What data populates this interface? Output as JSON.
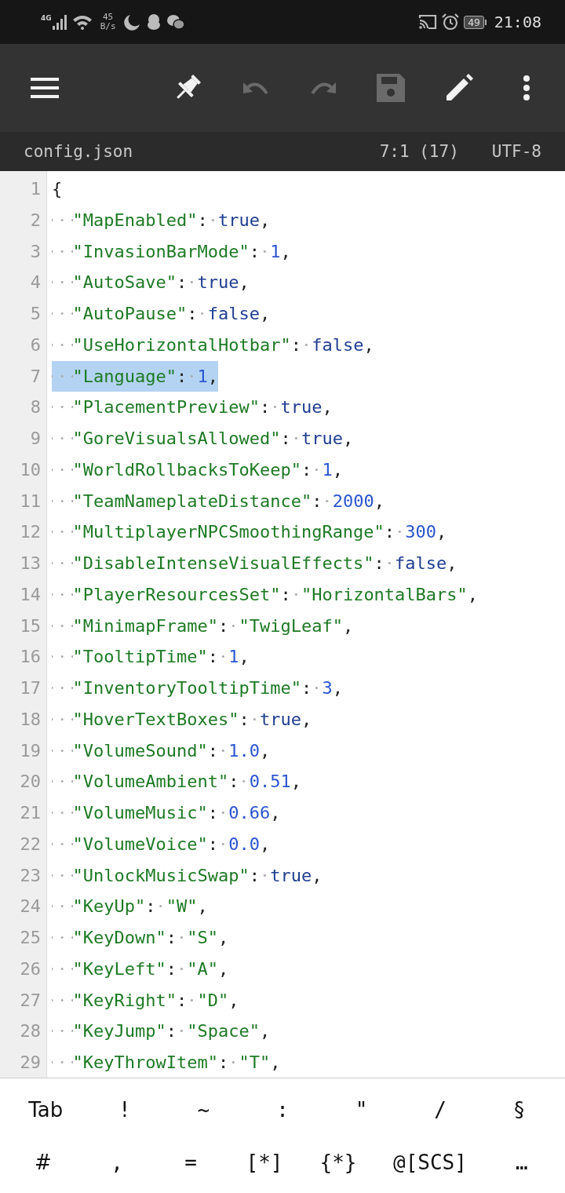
{
  "status_bar": {
    "network": "4G",
    "speed_value": "45",
    "speed_unit": "B/s",
    "battery": "49",
    "time": "21:08"
  },
  "toolbar": [
    {
      "disabled": false
    },
    {
      "disabled": false
    },
    {
      "disabled": true
    },
    {
      "disabled": true
    },
    {
      "disabled": true
    },
    {
      "disabled": false
    },
    {
      "disabled": false
    }
  ],
  "file_bar": {
    "filename": "config.json",
    "position": "7:1 (17)",
    "encoding": "UTF-8"
  },
  "lines": [
    {
      "number": "1",
      "kind": "brace",
      "text": "{",
      "selected": false
    },
    {
      "number": "2",
      "kind": "keyword",
      "key": "\"MapEnabled\"",
      "separator": ":",
      "value": "true",
      "tail": ",",
      "selected": false
    },
    {
      "number": "3",
      "kind": "number",
      "key": "\"InvasionBarMode\"",
      "separator": ":",
      "value": "1",
      "tail": ",",
      "selected": false
    },
    {
      "number": "4",
      "kind": "keyword",
      "key": "\"AutoSave\"",
      "separator": ":",
      "value": "true",
      "tail": ",",
      "selected": false
    },
    {
      "number": "5",
      "kind": "keyword",
      "key": "\"AutoPause\"",
      "separator": ":",
      "value": "false",
      "tail": ",",
      "selected": false
    },
    {
      "number": "6",
      "kind": "keyword",
      "key": "\"UseHorizontalHotbar\"",
      "separator": ":",
      "value": "false",
      "tail": ",",
      "selected": false
    },
    {
      "number": "7",
      "kind": "number",
      "key": "\"Language\"",
      "separator": ":",
      "value": "1",
      "tail": ",",
      "selected": true
    },
    {
      "number": "8",
      "kind": "keyword",
      "key": "\"PlacementPreview\"",
      "separator": ":",
      "value": "true",
      "tail": ",",
      "selected": false
    },
    {
      "number": "9",
      "kind": "keyword",
      "key": "\"GoreVisualsAllowed\"",
      "separator": ":",
      "value": "true",
      "tail": ",",
      "selected": false
    },
    {
      "number": "10",
      "kind": "number",
      "key": "\"WorldRollbacksToKeep\"",
      "separator": ":",
      "value": "1",
      "tail": ",",
      "selected": false
    },
    {
      "number": "11",
      "kind": "number",
      "key": "\"TeamNameplateDistance\"",
      "separator": ":",
      "value": "2000",
      "tail": ",",
      "selected": false
    },
    {
      "number": "12",
      "kind": "number",
      "key": "\"MultiplayerNPCSmoothingRange\"",
      "separator": ":",
      "value": "300",
      "tail": ",",
      "selected": false
    },
    {
      "number": "13",
      "kind": "keyword",
      "key": "\"DisableIntenseVisualEffects\"",
      "separator": ":",
      "value": "false",
      "tail": ",",
      "selected": false
    },
    {
      "number": "14",
      "kind": "string",
      "key": "\"PlayerResourcesSet\"",
      "separator": ":",
      "value": "\"HorizontalBars\"",
      "tail": ",",
      "selected": false
    },
    {
      "number": "15",
      "kind": "string",
      "key": "\"MinimapFrame\"",
      "separator": ":",
      "value": "\"TwigLeaf\"",
      "tail": ",",
      "selected": false
    },
    {
      "number": "16",
      "kind": "number",
      "key": "\"TooltipTime\"",
      "separator": ":",
      "value": "1",
      "tail": ",",
      "selected": false
    },
    {
      "number": "17",
      "kind": "number",
      "key": "\"InventoryTooltipTime\"",
      "separator": ":",
      "value": "3",
      "tail": ",",
      "selected": false
    },
    {
      "number": "18",
      "kind": "keyword",
      "key": "\"HoverTextBoxes\"",
      "separator": ":",
      "value": "true",
      "tail": ",",
      "selected": false
    },
    {
      "number": "19",
      "kind": "number",
      "key": "\"VolumeSound\"",
      "separator": ":",
      "value": "1.0",
      "tail": ",",
      "selected": false
    },
    {
      "number": "20",
      "kind": "number",
      "key": "\"VolumeAmbient\"",
      "separator": ":",
      "value": "0.51",
      "tail": ",",
      "selected": false
    },
    {
      "number": "21",
      "kind": "number",
      "key": "\"VolumeMusic\"",
      "separator": ":",
      "value": "0.66",
      "tail": ",",
      "selected": false
    },
    {
      "number": "22",
      "kind": "number",
      "key": "\"VolumeVoice\"",
      "separator": ":",
      "value": "0.0",
      "tail": ",",
      "selected": false
    },
    {
      "number": "23",
      "kind": "keyword",
      "key": "\"UnlockMusicSwap\"",
      "separator": ":",
      "value": "true",
      "tail": ",",
      "selected": false
    },
    {
      "number": "24",
      "kind": "string",
      "key": "\"KeyUp\"",
      "separator": ":",
      "value": "\"W\"",
      "tail": ",",
      "selected": false
    },
    {
      "number": "25",
      "kind": "string",
      "key": "\"KeyDown\"",
      "separator": ":",
      "value": "\"S\"",
      "tail": ",",
      "selected": false
    },
    {
      "number": "26",
      "kind": "string",
      "key": "\"KeyLeft\"",
      "separator": ":",
      "value": "\"A\"",
      "tail": ",",
      "selected": false
    },
    {
      "number": "27",
      "kind": "string",
      "key": "\"KeyRight\"",
      "separator": ":",
      "value": "\"D\"",
      "tail": ",",
      "selected": false
    },
    {
      "number": "28",
      "kind": "string",
      "key": "\"KeyJump\"",
      "separator": ":",
      "value": "\"Space\"",
      "tail": ",",
      "selected": false
    },
    {
      "number": "29",
      "kind": "string",
      "key": "\"KeyThrowItem\"",
      "separator": ":",
      "value": "\"T\"",
      "tail": ",",
      "selected": false
    }
  ],
  "extra_keys": [
    [
      "Tab",
      "!",
      "~",
      ":",
      "\"",
      "/",
      "§"
    ],
    [
      "#",
      ",",
      "=",
      "[*]",
      "{*}",
      "@[SCS]",
      "…"
    ]
  ]
}
